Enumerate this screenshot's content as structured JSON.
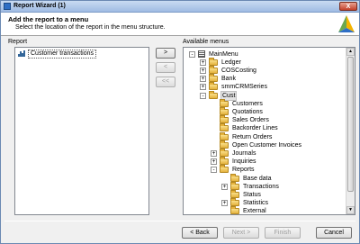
{
  "window": {
    "title": "Report Wizard (1)",
    "close_label": "X"
  },
  "header": {
    "title": "Add the report to a menu",
    "subtitle": "Select the location of the report in the menu structure."
  },
  "left": {
    "label": "Report",
    "items": [
      "Customer transactions"
    ]
  },
  "middle": {
    "add_label": ">",
    "remove_label": "<",
    "remove_all_label": "<<"
  },
  "right": {
    "label": "Available menus",
    "tree": [
      {
        "label": "MainMenu",
        "level": 0,
        "expander": "-",
        "icon": "menu"
      },
      {
        "label": "Ledger",
        "level": 1,
        "expander": "+",
        "icon": "folder"
      },
      {
        "label": "COSCosting",
        "level": 1,
        "expander": "+",
        "icon": "folder"
      },
      {
        "label": "Bank",
        "level": 1,
        "expander": "+",
        "icon": "folder"
      },
      {
        "label": "smmCRMSeries",
        "level": 1,
        "expander": "+",
        "icon": "folder"
      },
      {
        "label": "Cust",
        "level": 1,
        "expander": "-",
        "icon": "folder",
        "selected": true
      },
      {
        "label": "Customers",
        "level": 2,
        "expander": "",
        "icon": "folder"
      },
      {
        "label": "Quotations",
        "level": 2,
        "expander": "",
        "icon": "folder"
      },
      {
        "label": "Sales Orders",
        "level": 2,
        "expander": "",
        "icon": "folder"
      },
      {
        "label": "Backorder Lines",
        "level": 2,
        "expander": "",
        "icon": "folder"
      },
      {
        "label": "Return Orders",
        "level": 2,
        "expander": "",
        "icon": "folder"
      },
      {
        "label": "Open Customer Invoices",
        "level": 2,
        "expander": "",
        "icon": "folder"
      },
      {
        "label": "Journals",
        "level": 2,
        "expander": "+",
        "icon": "folder"
      },
      {
        "label": "Inquiries",
        "level": 2,
        "expander": "+",
        "icon": "folder"
      },
      {
        "label": "Reports",
        "level": 2,
        "expander": "-",
        "icon": "folder"
      },
      {
        "label": "Base data",
        "level": 3,
        "expander": "",
        "icon": "folder"
      },
      {
        "label": "Transactions",
        "level": 3,
        "expander": "+",
        "icon": "folder"
      },
      {
        "label": "Status",
        "level": 3,
        "expander": "",
        "icon": "folder"
      },
      {
        "label": "Statistics",
        "level": 3,
        "expander": "+",
        "icon": "folder"
      },
      {
        "label": "External",
        "level": 3,
        "expander": "",
        "icon": "folder"
      }
    ]
  },
  "footer": {
    "back_label": "< Back",
    "next_label": "Next >",
    "finish_label": "Finish",
    "cancel_label": "Cancel"
  },
  "colors": {
    "accent": "#2f6fc5",
    "folder": "#e5b23c",
    "titlebar": "#9fbbe3"
  }
}
